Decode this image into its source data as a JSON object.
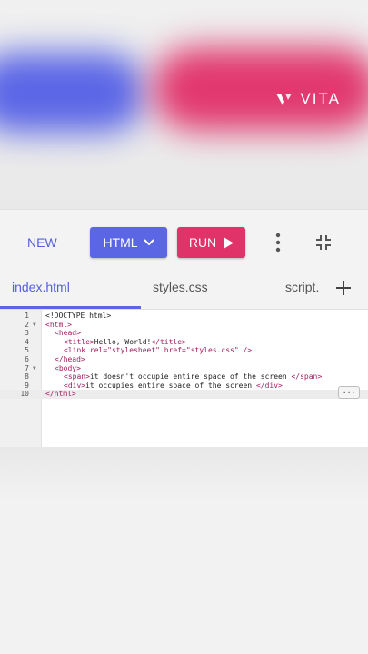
{
  "brand": {
    "logo_text": "VITA"
  },
  "toolbar": {
    "new_label": "NEW",
    "language_label": "HTML",
    "run_label": "RUN"
  },
  "tabs": [
    {
      "label": "index.html",
      "active": true
    },
    {
      "label": "styles.css",
      "active": false
    },
    {
      "label": "script.",
      "active": false
    }
  ],
  "editor": {
    "line_numbers": [
      "1",
      "2",
      "3",
      "4",
      "5",
      "6",
      "7",
      "8",
      "9",
      "10"
    ],
    "lines": [
      [
        {
          "t": "dt",
          "v": "<!DOCTYPE html>"
        }
      ],
      [
        {
          "t": "tag",
          "v": "<html>"
        }
      ],
      [
        {
          "t": "tag",
          "v": "<head>"
        }
      ],
      [
        {
          "t": "tag",
          "v": "<title>"
        },
        {
          "t": "txt",
          "v": "Hello, World!"
        },
        {
          "t": "tag",
          "v": "</title>"
        }
      ],
      [
        {
          "t": "tag",
          "v": "<link "
        },
        {
          "t": "attr",
          "v": "rel="
        },
        {
          "t": "str",
          "v": "\"stylesheet\""
        },
        {
          "t": "attr",
          "v": " href="
        },
        {
          "t": "str",
          "v": "\"styles.css\""
        },
        {
          "t": "tag",
          "v": " />"
        }
      ],
      [
        {
          "t": "tag",
          "v": "</head>"
        }
      ],
      [
        {
          "t": "tag",
          "v": "<body>"
        }
      ],
      [
        {
          "t": "tag",
          "v": "<span>"
        },
        {
          "t": "txt",
          "v": "it doesn't occupie entire space of the screen "
        },
        {
          "t": "tag",
          "v": "</span>"
        }
      ],
      [
        {
          "t": "tag",
          "v": "<div>"
        },
        {
          "t": "txt",
          "v": "it occupies entire space of the screen "
        },
        {
          "t": "tag",
          "v": "</div>"
        }
      ],
      [
        {
          "t": "tag",
          "v": "</html>"
        }
      ]
    ],
    "active_line": 10,
    "overflow_button": "..."
  },
  "colors": {
    "accent_blue": "#5a66e4",
    "accent_pink": "#e0336a",
    "code_tag": "#a21d5f"
  },
  "icons": {
    "logo": "vita-logo-icon",
    "html_chevron": "chevron-down-icon",
    "run": "play-icon",
    "more": "more-vertical-icon",
    "collapse": "collapse-icon",
    "add_tab": "plus-icon"
  }
}
